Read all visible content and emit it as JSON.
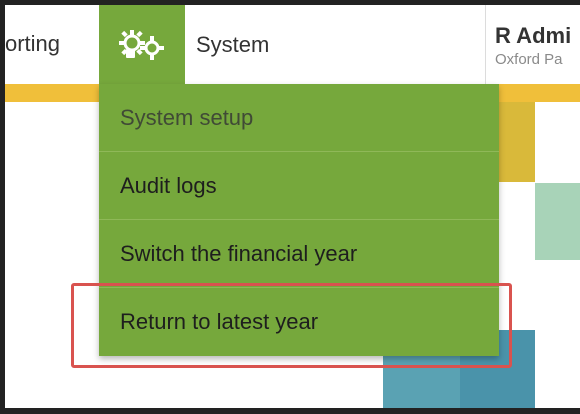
{
  "nav": {
    "reporting_label": "orting",
    "system_label": "System",
    "system_icon": "gears-icon"
  },
  "user": {
    "name": "R Admi",
    "org": "Oxford Pa"
  },
  "system_menu": {
    "items": [
      {
        "label": "System setup"
      },
      {
        "label": "Audit logs"
      },
      {
        "label": "Switch the financial year"
      },
      {
        "label": "Return to latest year"
      }
    ]
  },
  "colors": {
    "nav_active": "#76a83c",
    "accent_bar": "#f0bf3a",
    "highlight_border": "#d9534f"
  }
}
